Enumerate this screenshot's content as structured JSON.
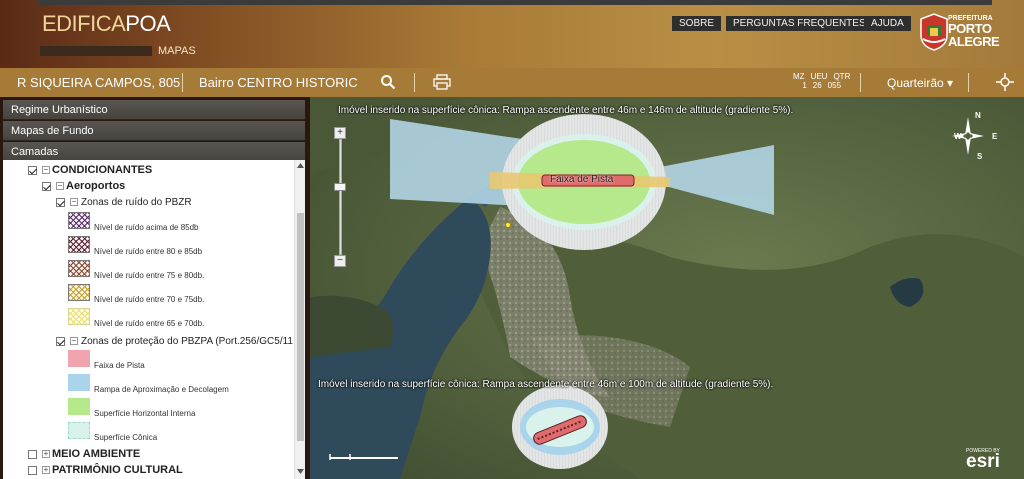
{
  "header": {
    "brand_left": "EDIFICA",
    "brand_right": "POA",
    "subtitle": "MAPAS",
    "buttons": [
      "SOBRE",
      "PERGUNTAS FREQUENTES",
      "AJUDA"
    ],
    "logo_small": "PREFEITURA",
    "logo_line1": "PORTO",
    "logo_line2": "ALEGRE"
  },
  "toolbar": {
    "address": "R SIQUEIRA CAMPOS, 805",
    "bairro": "Bairro CENTRO HISTORIC",
    "zone_labels": [
      "MZ",
      "UEU",
      "QTR"
    ],
    "zone_values": [
      "1",
      "26",
      "055"
    ],
    "dropdown": "Quarteirão ▾",
    "icons": [
      "search-icon",
      "print-icon",
      "move-icon"
    ]
  },
  "panel": {
    "sections": [
      "Regime Urbanístico",
      "Mapas de Fundo",
      "Camadas"
    ],
    "tree": {
      "condicionantes": "CONDICIONANTES",
      "aeroportos": "Aeroportos",
      "zonas_ruido": "Zonas de ruído do PBZR",
      "ruido_items": [
        "Nível de ruído acima de 85db",
        "Nível de ruído entre 80 e 85db",
        "Nível de ruído entre 75 e 80db.",
        "Nível de ruído entre 70 e 75db.",
        "Nível de ruído entre 65 e 70db."
      ],
      "zonas_protecao": "Zonas de proteção do PBZPA (Port.256/GC5/11",
      "protecao_items": [
        "Faixa de Pista",
        "Rampa de Aproximação e Decolagem",
        "Superfície Horizontal Interna",
        "Superfície Cônica"
      ],
      "meio_ambiente": "MEIO AMBIENTE",
      "patrimonio": "PATRIMÔNIO CULTURAL"
    }
  },
  "map": {
    "label_top": "Imóvel inserido na superfície cônica: Rampa ascendente entre 46m e 146m de altitude (gradiente 5%).",
    "label_pista": "Faixa de Pista",
    "label_bottom": "Imóvel inserido na superfície cônica: Rampa ascendente entre 46m e 100m de altitude (gradiente 5%).",
    "compass": {
      "n": "N",
      "s": "S",
      "e": "E",
      "w": "W"
    },
    "esri_small": "POWERED BY",
    "esri": "esri"
  },
  "colors": {
    "header": "#b98f45",
    "toolbar": "#a67b38",
    "accordion": "#4f4a46",
    "pista": "#e06b6b",
    "rampa": "#a9d4ec",
    "horizontal": "#b6e88c",
    "conica": "#d9f3ec"
  }
}
